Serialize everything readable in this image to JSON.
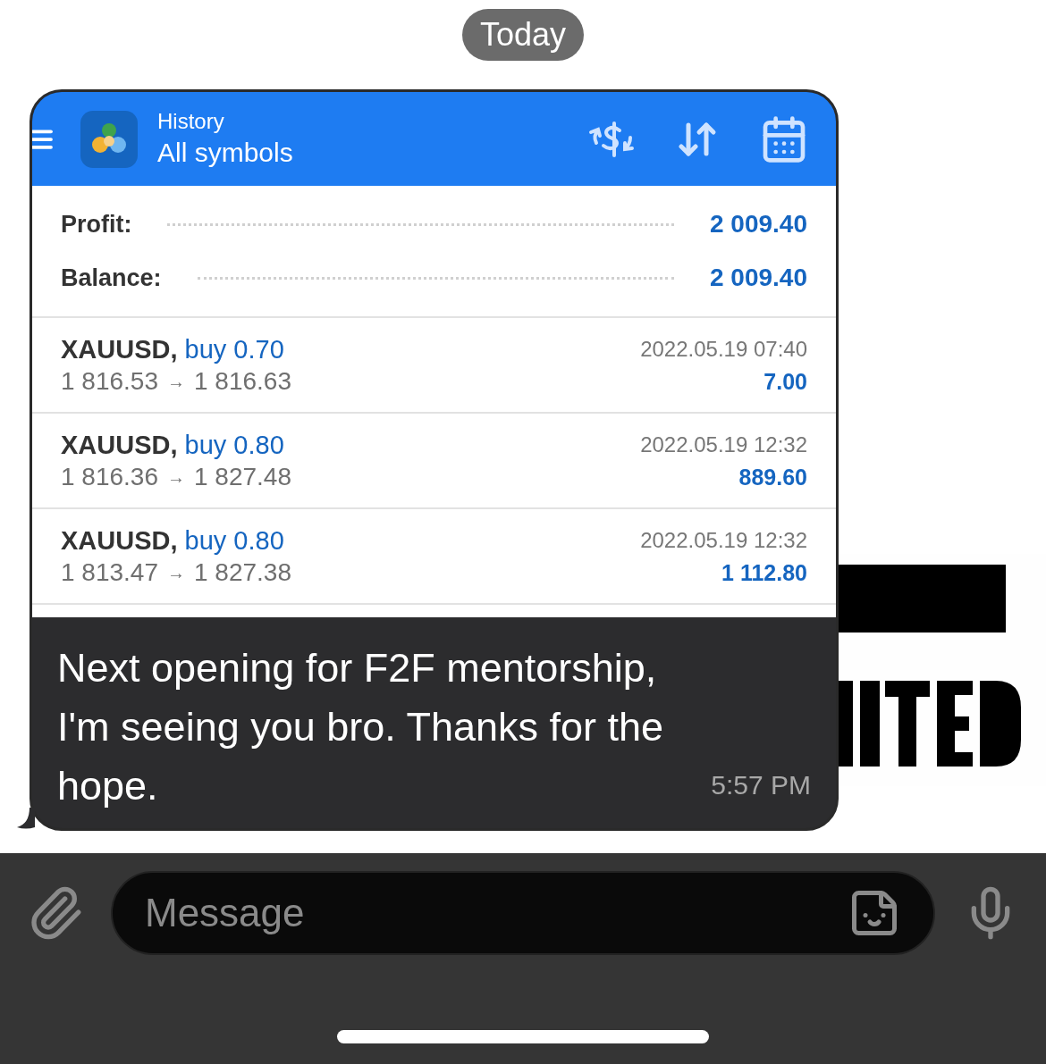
{
  "date_badge": "Today",
  "app_screenshot": {
    "header": {
      "subtitle": "History",
      "title": "All symbols"
    },
    "summary": [
      {
        "label": "Profit:",
        "value": "2 009.40"
      },
      {
        "label": "Balance:",
        "value": "2 009.40"
      }
    ],
    "deals": [
      {
        "symbol": "XAUUSD,",
        "side": "buy 0.70",
        "open_price": "1 816.53",
        "arrow": "→",
        "close_price": "1 816.63",
        "time": "2022.05.19 07:40",
        "profit": "7.00"
      },
      {
        "symbol": "XAUUSD,",
        "side": "buy 0.80",
        "open_price": "1 816.36",
        "arrow": "→",
        "close_price": "1 827.48",
        "time": "2022.05.19 12:32",
        "profit": "889.60"
      },
      {
        "symbol": "XAUUSD,",
        "side": "buy 0.80",
        "open_price": "1 813.47",
        "arrow": "→",
        "close_price": "1 827.38",
        "time": "2022.05.19 12:32",
        "profit": "1 112.80"
      }
    ]
  },
  "message": {
    "text": "Next opening for F2F mentorship, I'm seeing you bro. Thanks for the hope.",
    "time": "5:57 PM"
  },
  "composer": {
    "placeholder": "Message"
  }
}
